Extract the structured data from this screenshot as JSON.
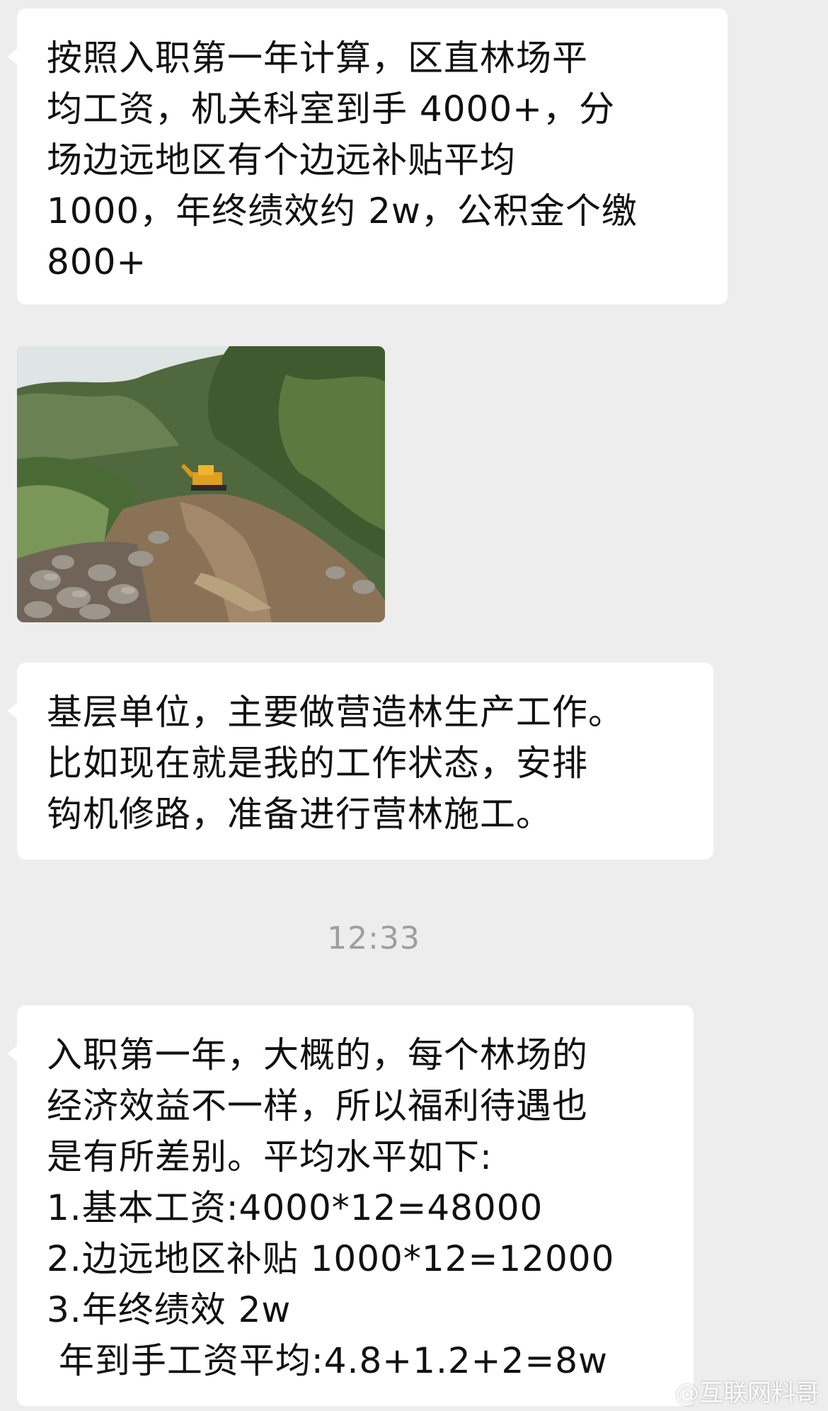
{
  "messages": [
    {
      "id": "msg1",
      "lines": [
        "按照入职第一年计算，区直林场平",
        "均工资，机关科室到手 4000+，分",
        "场边远地区有个边远补贴平均",
        "1000，年终绩效约 2w，公积金个缴",
        "800+"
      ]
    },
    {
      "id": "msg3",
      "lines": [
        "基层单位，主要做营造林生产工作。",
        "比如现在就是我的工作状态，安排",
        "钩机修路，准备进行营林施工。"
      ]
    },
    {
      "id": "msg4",
      "lines": [
        "入职第一年，大概的，每个林场的",
        "经济效益不一样，所以福利待遇也",
        "是有所差别。平均水平如下:",
        "1.基本工资:4000*12=48000",
        "2.边远地区补贴 1000*12=12000",
        "3.年终绩效 2w",
        " 年到手工资平均:4.8+1.2+2=8w"
      ]
    }
  ],
  "timestamp": "12:33",
  "watermark": "@互联网料哥",
  "icons": {
    "watermark_logo": "weibo-logo-icon"
  },
  "colors": {
    "background": "#ededed",
    "bubble": "#ffffff",
    "timestamp": "#9e9e9e"
  }
}
